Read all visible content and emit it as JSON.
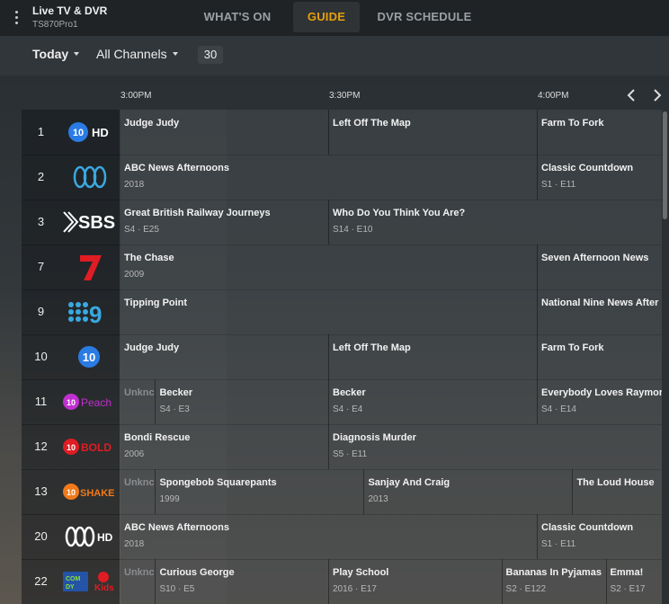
{
  "app": {
    "title": "Live TV & DVR",
    "subtitle": "TS870Pro1"
  },
  "tabs": [
    {
      "label": "WHAT'S ON",
      "active": false
    },
    {
      "label": "GUIDE",
      "active": true
    },
    {
      "label": "DVR SCHEDULE",
      "active": false
    }
  ],
  "filters": {
    "day": "Today",
    "channels": "All Channels",
    "count": "30"
  },
  "timeline": [
    "3:00PM",
    "3:30PM",
    "4:00PM"
  ],
  "colors": {
    "accent": "#e5a00d"
  },
  "rows": [
    {
      "number": "1",
      "logo": "10-hd-logo",
      "programs": [
        {
          "title": "Judge Judy",
          "meta": ""
        },
        {
          "title": "Left Off The Map",
          "meta": ""
        },
        {
          "title": "Farm To Fork",
          "meta": ""
        }
      ]
    },
    {
      "number": "2",
      "logo": "abc-logo",
      "programs": [
        {
          "title": "ABC News Afternoons",
          "meta": "2018"
        },
        {
          "title": "Classic Countdown",
          "meta": "S1 · E11"
        }
      ]
    },
    {
      "number": "3",
      "logo": "sbs-logo",
      "programs": [
        {
          "title": "Great British Railway Journeys",
          "meta": "S4 · E25"
        },
        {
          "title": "Who Do You Think You Are?",
          "meta": "S14 · E10"
        }
      ]
    },
    {
      "number": "7",
      "logo": "seven-logo",
      "programs": [
        {
          "title": "The Chase",
          "meta": "2009"
        },
        {
          "title": "Seven Afternoon News",
          "meta": ""
        }
      ]
    },
    {
      "number": "9",
      "logo": "nine-logo",
      "programs": [
        {
          "title": "Tipping Point",
          "meta": ""
        },
        {
          "title": "National Nine News After",
          "meta": ""
        }
      ]
    },
    {
      "number": "10",
      "logo": "ten-logo",
      "programs": [
        {
          "title": "Judge Judy",
          "meta": ""
        },
        {
          "title": "Left Off The Map",
          "meta": ""
        },
        {
          "title": "Farm To Fork",
          "meta": ""
        }
      ]
    },
    {
      "number": "11",
      "logo": "10-peach-logo",
      "programs": [
        {
          "title": "Unknc",
          "meta": ""
        },
        {
          "title": "Becker",
          "meta": "S4 · E3"
        },
        {
          "title": "Becker",
          "meta": "S4 · E4"
        },
        {
          "title": "Everybody Loves Raymor",
          "meta": "S4 · E14"
        }
      ]
    },
    {
      "number": "12",
      "logo": "10-bold-logo",
      "programs": [
        {
          "title": "Bondi Rescue",
          "meta": "2006"
        },
        {
          "title": "Diagnosis Murder",
          "meta": "S5 · E11"
        }
      ]
    },
    {
      "number": "13",
      "logo": "10-shake-logo",
      "programs": [
        {
          "title": "Unknc",
          "meta": ""
        },
        {
          "title": "Spongebob Squarepants",
          "meta": "1999"
        },
        {
          "title": "Sanjay And Craig",
          "meta": "2013"
        },
        {
          "title": "The Loud House",
          "meta": ""
        }
      ]
    },
    {
      "number": "20",
      "logo": "abc-hd-logo",
      "programs": [
        {
          "title": "ABC News Afternoons",
          "meta": "2018"
        },
        {
          "title": "Classic Countdown",
          "meta": "S1 · E11"
        }
      ]
    },
    {
      "number": "22",
      "logo": "abc-kids-comedy-logo",
      "programs": [
        {
          "title": "Unknc",
          "meta": ""
        },
        {
          "title": "Curious George",
          "meta": "S10 · E5"
        },
        {
          "title": "Play School",
          "meta": "2016 · E17"
        },
        {
          "title": "Bananas In Pyjamas",
          "meta": "S2 · E122"
        },
        {
          "title": "Emma!",
          "meta": "S2 · E17"
        }
      ]
    }
  ]
}
